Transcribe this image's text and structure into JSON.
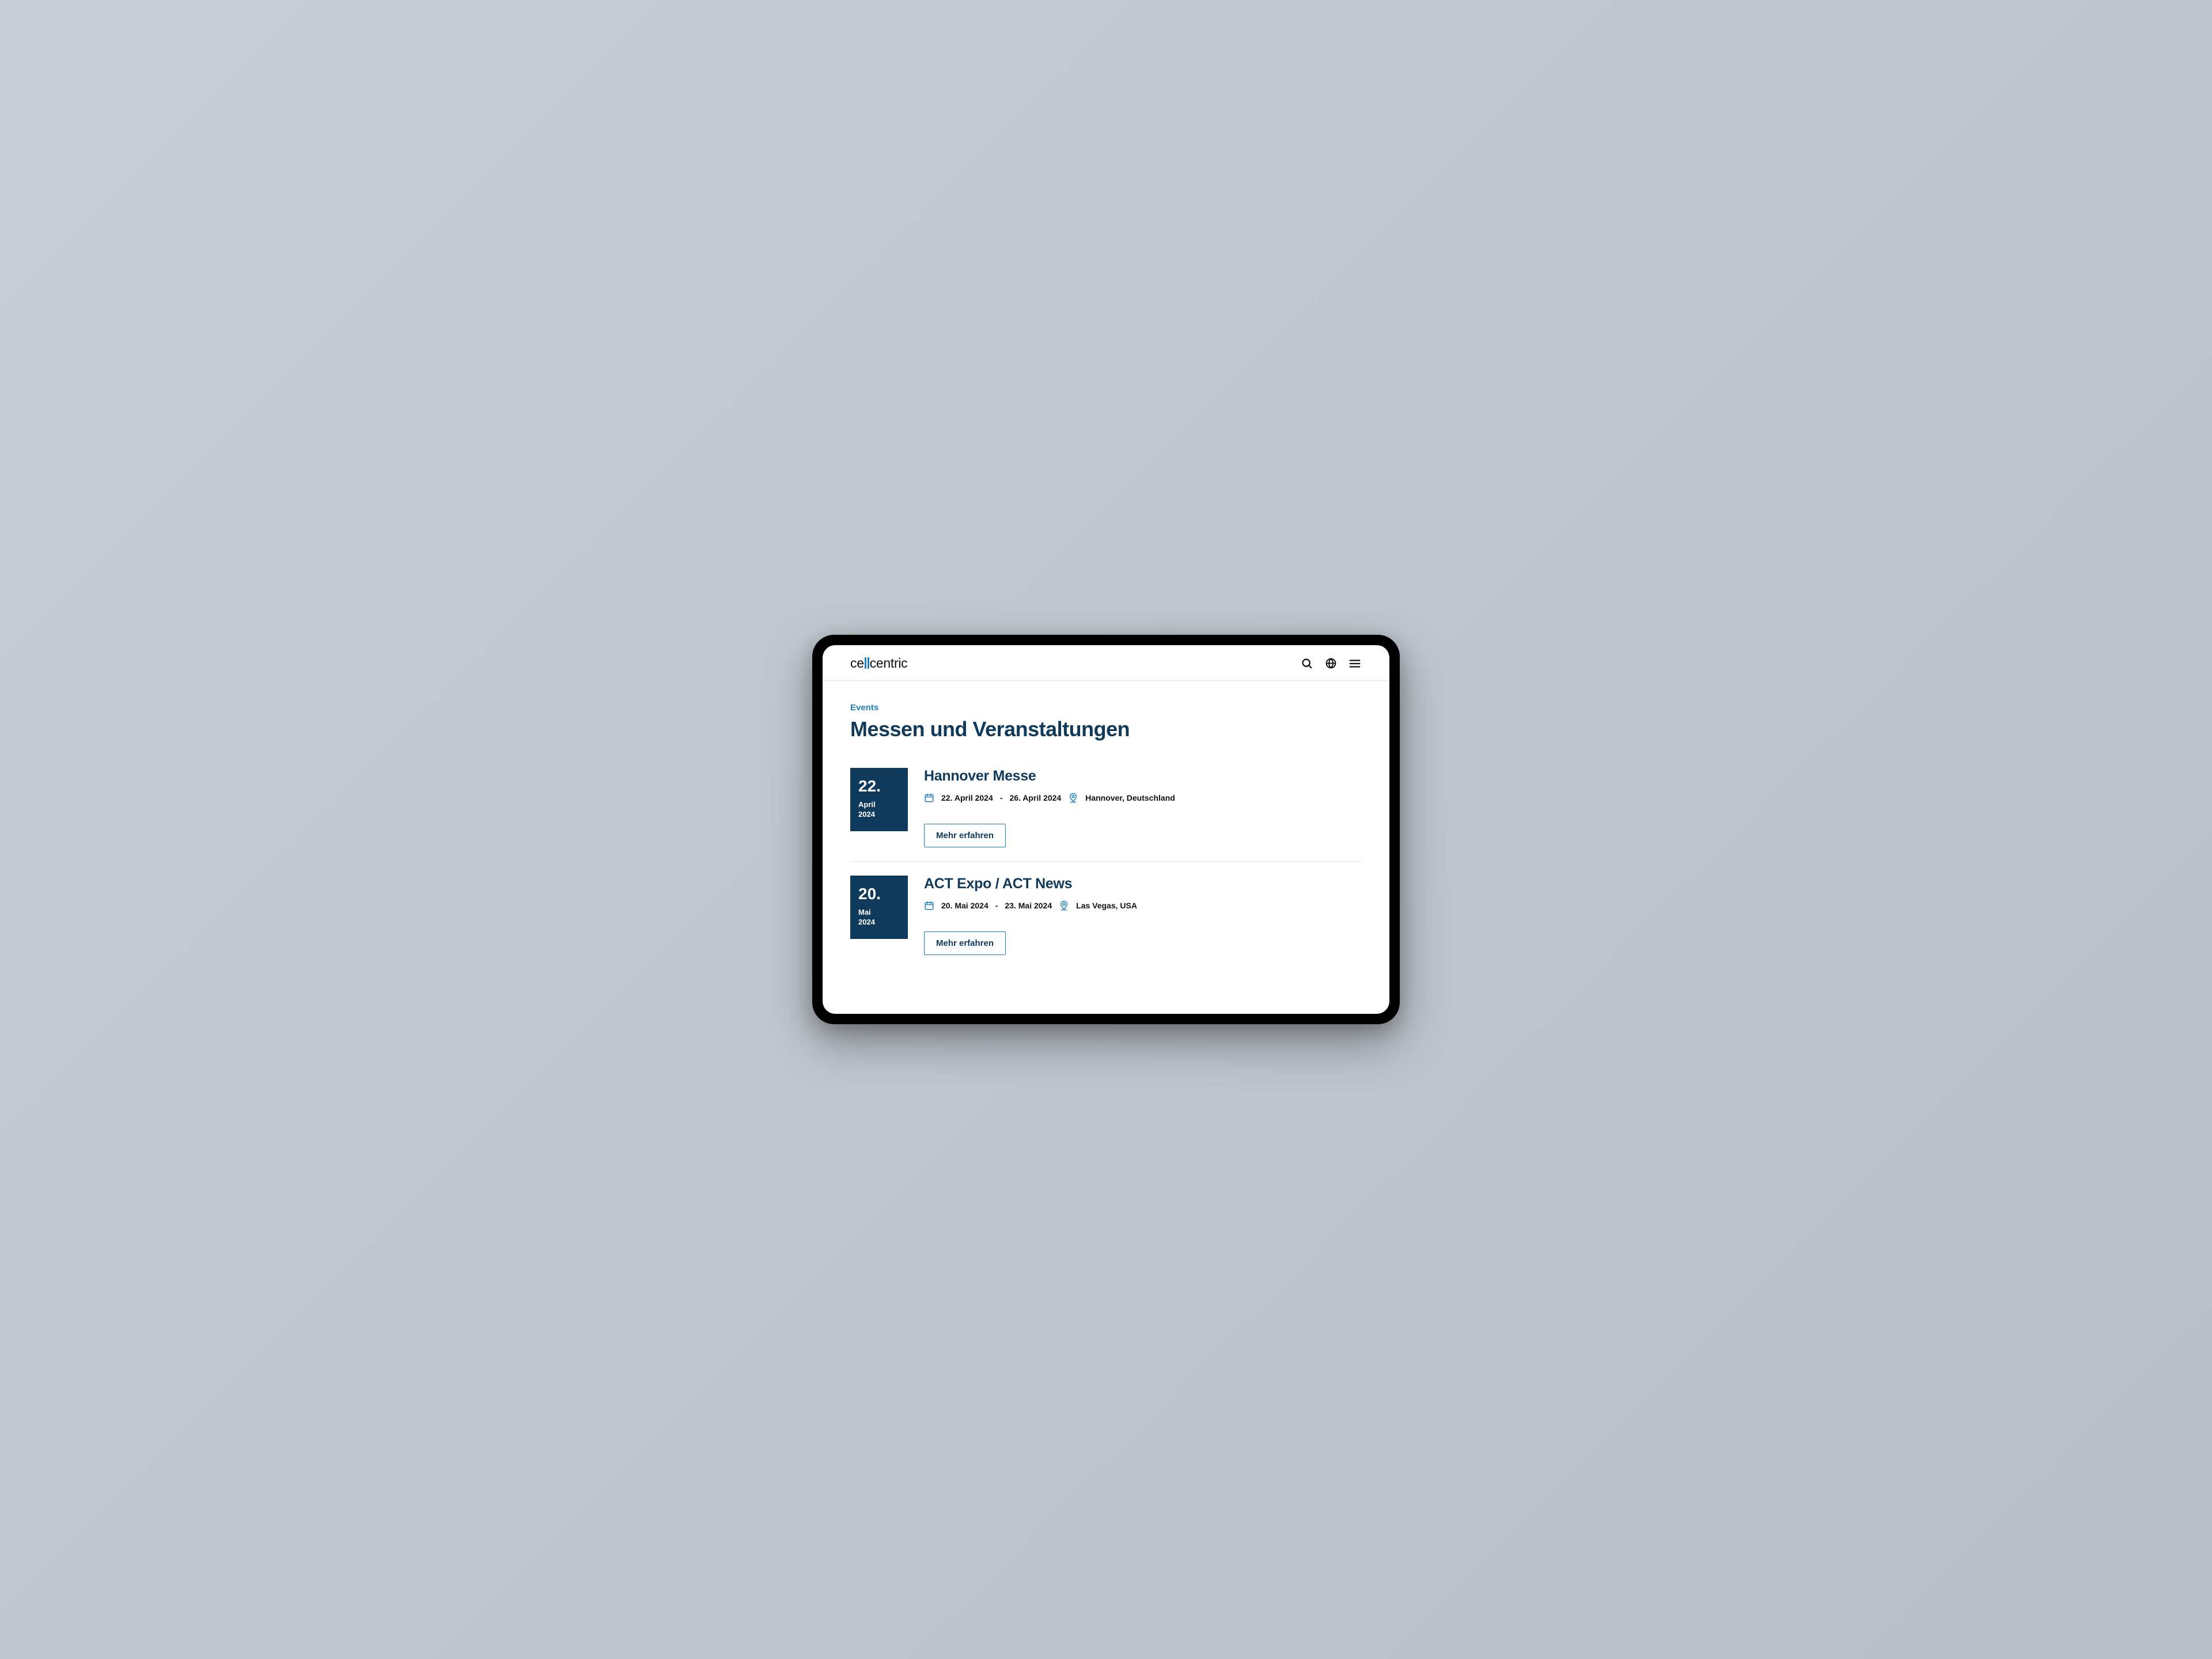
{
  "brand": {
    "pre": "ce",
    "post": "centric"
  },
  "page": {
    "eyebrow": "Events",
    "title": "Messen und Veranstaltungen"
  },
  "events": [
    {
      "dateBlock": {
        "day": "22.",
        "month": "April",
        "year": "2024"
      },
      "title": "Hannover Messe",
      "startDate": "22. April 2024",
      "endDate": "26. April 2024",
      "location": "Hannover, Deutschland",
      "cta": "Mehr erfahren"
    },
    {
      "dateBlock": {
        "day": "20.",
        "month": "Mai",
        "year": "2024"
      },
      "title": "ACT Expo / ACT News",
      "startDate": "20. Mai 2024",
      "endDate": "23. Mai 2024",
      "location": "Las Vegas, USA",
      "cta": "Mehr erfahren"
    }
  ],
  "separator": "-"
}
